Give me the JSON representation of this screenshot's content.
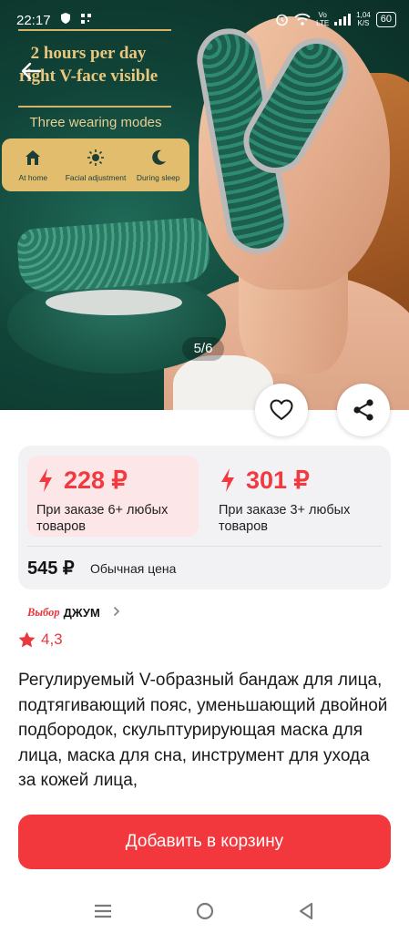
{
  "status_bar": {
    "time": "22:17",
    "network_label": "Vo\nLTE",
    "speed_value": "1,04",
    "speed_unit": "K/S",
    "battery": "60"
  },
  "gallery": {
    "headline": "2 hours per day\nright V-face visible",
    "modes_title": "Three wearing modes",
    "modes": [
      {
        "icon": "home-icon",
        "label": "At home"
      },
      {
        "icon": "sun-icon",
        "label": "Facial adjustment"
      },
      {
        "icon": "moon-icon",
        "label": "During sleep"
      }
    ],
    "counter": "5/6"
  },
  "prices": {
    "offer_1": {
      "price": "228 ₽",
      "description": "При заказе 6+ любых товаров"
    },
    "offer_2": {
      "price": "301 ₽",
      "description": "При заказе 3+ любых товаров"
    },
    "regular_price": "545 ₽",
    "regular_label": "Обычная цена"
  },
  "brand": {
    "badge": "Выбор",
    "name": "ДЖУМ"
  },
  "rating": "4,3",
  "title": "Регулируемый V-образный бандаж для лица, подтягивающий пояс, уменьшающий двойной подбородок, скульптурирующая маска для лица, маска для сна, инструмент для ухода за кожей лица,",
  "cart_button": "Добавить в корзину",
  "colors": {
    "accent": "#f2373d",
    "offer_bg": "#fde6e8",
    "card_bg": "#f2f2f4"
  }
}
